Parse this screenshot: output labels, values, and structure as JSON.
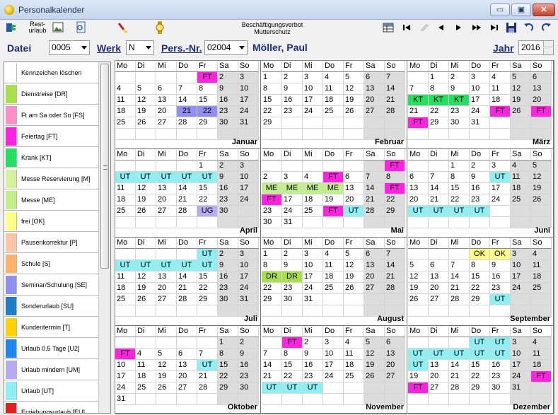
{
  "window": {
    "title": "Personalkalender",
    "minimize": "▭",
    "maximize": "▣",
    "close": "✕"
  },
  "toolbar": {
    "resturlaub_label_1": "Rest-",
    "resturlaub_label_2": "urlaub",
    "center_label_1": "Beschäftigungsverbot",
    "center_label_2": "Mutterschutz"
  },
  "filter": {
    "datei_label": "Datei",
    "datei_value": "0005",
    "werk_label": "Werk",
    "werk_value": "N",
    "persnr_label": "Pers.-Nr.",
    "persnr_value": "02004",
    "person_name": "Möller, Paul",
    "jahr_label": "Jahr",
    "jahr_value": "2016"
  },
  "legend": [
    {
      "label": "Kennzeichen löschen",
      "color": "#ffffff"
    },
    {
      "label": "Dienstreise [DR]",
      "color": "#a8e04a"
    },
    {
      "label": "Ft am Sa oder So [FS]",
      "color": "#ff8fc8"
    },
    {
      "label": "Feiertag [FT]",
      "color": "#ff22e0"
    },
    {
      "label": "Krank [KT]",
      "color": "#22e060"
    },
    {
      "label": "Messe Reservierung [M]",
      "color": "#d4f29a"
    },
    {
      "label": "Messe [ME]",
      "color": "#c2ee8c"
    },
    {
      "label": "frei [OK]",
      "color": "#ffff88"
    },
    {
      "label": "Pausenkorrektur [P]",
      "color": "#ffc4a8"
    },
    {
      "label": "Schule [S]",
      "color": "#ffb06a"
    },
    {
      "label": "Seminar/Schulung [SE]",
      "color": "#8f8ff2"
    },
    {
      "label": "Sonderurlaub [SU]",
      "color": "#1e7ec8"
    },
    {
      "label": "Kundentermin [T]",
      "color": "#ffd200"
    },
    {
      "label": "Urlaub 0.5 Tage [U2]",
      "color": "#1e86f0"
    },
    {
      "label": "Urlaub mindern [UM]",
      "color": "#b6acf0"
    },
    {
      "label": "Urlaub [UT]",
      "color": "#8ff0f4"
    },
    {
      "label": "Erziehungsurlaub [EU]",
      "color": "#e02020"
    }
  ],
  "marks": {
    "FT": "#ff22e0",
    "UT": "#8ff0f4",
    "KT": "#22e060",
    "ME": "#c2ee8c",
    "DR": "#a8e04a",
    "OK": "#ffff88",
    "UG": "#b6acf0",
    "SE": "#8f8ff2"
  },
  "weekdays": [
    "Mo",
    "Di",
    "Mi",
    "Do",
    "Fr",
    "Sa",
    "So"
  ],
  "months": [
    {
      "name": "Januar",
      "rows": [
        [
          "",
          "",
          "",
          "",
          "FT",
          "2",
          "3"
        ],
        [
          "4",
          "5",
          "6",
          "7",
          "8",
          "9",
          "10"
        ],
        [
          "11",
          "12",
          "13",
          "14",
          "15",
          "16",
          "17"
        ],
        [
          "18",
          "19",
          "20",
          "21",
          "22",
          "23",
          "24"
        ],
        [
          "25",
          "26",
          "27",
          "28",
          "29",
          "30",
          "31"
        ],
        [
          "",
          "",
          "",
          "",
          "",
          "",
          ""
        ]
      ],
      "colors": {
        "0,4": "FT",
        "3,3": "SE",
        "3,4": "SE"
      }
    },
    {
      "name": "Februar",
      "rows": [
        [
          "1",
          "2",
          "3",
          "4",
          "5",
          "6",
          "7"
        ],
        [
          "8",
          "9",
          "10",
          "11",
          "12",
          "13",
          "14"
        ],
        [
          "15",
          "16",
          "17",
          "18",
          "19",
          "20",
          "21"
        ],
        [
          "22",
          "23",
          "24",
          "25",
          "26",
          "27",
          "28"
        ],
        [
          "29",
          "",
          "",
          "",
          "",
          "",
          ""
        ],
        [
          "",
          "",
          "",
          "",
          "",
          "",
          ""
        ]
      ],
      "colors": {}
    },
    {
      "name": "März",
      "rows": [
        [
          "",
          "1",
          "2",
          "3",
          "4",
          "5",
          "6"
        ],
        [
          "7",
          "8",
          "9",
          "10",
          "11",
          "12",
          "13"
        ],
        [
          "KT",
          "KT",
          "KT",
          "17",
          "18",
          "19",
          "20"
        ],
        [
          "21",
          "22",
          "23",
          "24",
          "FT",
          "26",
          "FT"
        ],
        [
          "FT",
          "29",
          "30",
          "31",
          "",
          "",
          ""
        ],
        [
          "",
          "",
          "",
          "",
          "",
          "",
          ""
        ]
      ],
      "colors": {
        "2,0": "KT",
        "2,1": "KT",
        "2,2": "KT",
        "3,4": "FT",
        "3,6": "FT",
        "4,0": "FT"
      }
    },
    {
      "name": "April",
      "rows": [
        [
          "",
          "",
          "",
          "",
          "1",
          "2",
          "3"
        ],
        [
          "UT",
          "UT",
          "UT",
          "UT",
          "UT",
          "9",
          "10"
        ],
        [
          "11",
          "12",
          "13",
          "14",
          "15",
          "16",
          "17"
        ],
        [
          "18",
          "19",
          "20",
          "21",
          "22",
          "23",
          "24"
        ],
        [
          "25",
          "26",
          "27",
          "28",
          "UG",
          "30",
          ""
        ],
        [
          "",
          "",
          "",
          "",
          "",
          "",
          ""
        ]
      ],
      "colors": {
        "1,0": "UT",
        "1,1": "UT",
        "1,2": "UT",
        "1,3": "UT",
        "1,4": "UT",
        "4,4": "UG"
      }
    },
    {
      "name": "Mai",
      "rows": [
        [
          "",
          "",
          "",
          "",
          "",
          "",
          "FT"
        ],
        [
          "2",
          "3",
          "4",
          "FT",
          "6",
          "7",
          "8"
        ],
        [
          "ME",
          "ME",
          "ME",
          "ME",
          "13",
          "14",
          "FT"
        ],
        [
          "FT",
          "17",
          "18",
          "19",
          "20",
          "21",
          "22"
        ],
        [
          "23",
          "24",
          "25",
          "FT",
          "UT",
          "28",
          "29"
        ],
        [
          "30",
          "31",
          "",
          "",
          "",
          "",
          ""
        ]
      ],
      "colors": {
        "0,6": "FT",
        "1,3": "FT",
        "2,0": "ME",
        "2,1": "ME",
        "2,2": "ME",
        "2,3": "ME",
        "2,6": "FT",
        "3,0": "FT",
        "4,3": "FT",
        "4,4": "UT"
      }
    },
    {
      "name": "Juni",
      "rows": [
        [
          "",
          "",
          "1",
          "2",
          "3",
          "4",
          "5"
        ],
        [
          "6",
          "7",
          "8",
          "9",
          "UT",
          "11",
          "12"
        ],
        [
          "13",
          "14",
          "15",
          "16",
          "17",
          "18",
          "19"
        ],
        [
          "20",
          "21",
          "22",
          "23",
          "24",
          "25",
          "26"
        ],
        [
          "UT",
          "UT",
          "UT",
          "UT",
          "",
          "",
          ""
        ],
        [
          "",
          "",
          "",
          "",
          "",
          "",
          ""
        ]
      ],
      "colors": {
        "1,4": "UT",
        "4,0": "UT",
        "4,1": "UT",
        "4,2": "UT",
        "4,3": "UT"
      }
    },
    {
      "name": "Juli",
      "rows": [
        [
          "",
          "",
          "",
          "",
          "UT",
          "2",
          "3"
        ],
        [
          "UT",
          "UT",
          "UT",
          "UT",
          "UT",
          "9",
          "10"
        ],
        [
          "11",
          "12",
          "13",
          "14",
          "15",
          "16",
          "17"
        ],
        [
          "18",
          "19",
          "20",
          "21",
          "22",
          "23",
          "24"
        ],
        [
          "25",
          "26",
          "27",
          "28",
          "29",
          "30",
          "31"
        ],
        [
          "",
          "",
          "",
          "",
          "",
          "",
          ""
        ]
      ],
      "colors": {
        "0,4": "UT",
        "1,0": "UT",
        "1,1": "UT",
        "1,2": "UT",
        "1,3": "UT",
        "1,4": "UT"
      }
    },
    {
      "name": "August",
      "rows": [
        [
          "1",
          "2",
          "3",
          "4",
          "5",
          "6",
          "7"
        ],
        [
          "8",
          "9",
          "10",
          "11",
          "12",
          "13",
          "14"
        ],
        [
          "DR",
          "DR",
          "17",
          "18",
          "19",
          "20",
          "21"
        ],
        [
          "22",
          "23",
          "24",
          "25",
          "26",
          "27",
          "28"
        ],
        [
          "29",
          "30",
          "31",
          "",
          "",
          "",
          ""
        ],
        [
          "",
          "",
          "",
          "",
          "",
          "",
          ""
        ]
      ],
      "colors": {
        "2,0": "DR",
        "2,1": "DR"
      }
    },
    {
      "name": "September",
      "rows": [
        [
          "",
          "",
          "",
          "OK",
          "OK",
          "3",
          "4"
        ],
        [
          "5",
          "6",
          "7",
          "8",
          "9",
          "10",
          "11"
        ],
        [
          "12",
          "13",
          "14",
          "15",
          "16",
          "17",
          "18"
        ],
        [
          "19",
          "20",
          "21",
          "22",
          "23",
          "24",
          "25"
        ],
        [
          "26",
          "27",
          "28",
          "29",
          "UT",
          "",
          ""
        ],
        [
          "",
          "",
          "",
          "",
          "",
          "",
          ""
        ]
      ],
      "colors": {
        "0,3": "OK",
        "0,4": "OK",
        "4,4": "UT"
      }
    },
    {
      "name": "Oktober",
      "rows": [
        [
          "",
          "",
          "",
          "",
          "",
          "1",
          "2"
        ],
        [
          "FT",
          "4",
          "5",
          "6",
          "7",
          "8",
          "9"
        ],
        [
          "10",
          "11",
          "12",
          "13",
          "UT",
          "15",
          "16"
        ],
        [
          "17",
          "18",
          "19",
          "20",
          "21",
          "22",
          "23"
        ],
        [
          "24",
          "25",
          "26",
          "27",
          "28",
          "29",
          "30"
        ],
        [
          "31",
          "",
          "",
          "",
          "",
          "",
          ""
        ]
      ],
      "colors": {
        "1,0": "FT",
        "2,4": "UT"
      }
    },
    {
      "name": "November",
      "rows": [
        [
          "",
          "FT",
          "2",
          "3",
          "4",
          "5",
          "6"
        ],
        [
          "7",
          "8",
          "9",
          "10",
          "11",
          "12",
          "13"
        ],
        [
          "14",
          "15",
          "16",
          "17",
          "18",
          "19",
          "20"
        ],
        [
          "21",
          "22",
          "23",
          "24",
          "25",
          "26",
          "27"
        ],
        [
          "UT",
          "UT",
          "UT",
          "",
          "",
          "",
          ""
        ],
        [
          "",
          "",
          "",
          "",
          "",
          "",
          ""
        ]
      ],
      "colors": {
        "0,1": "FT",
        "4,0": "UT",
        "4,1": "UT",
        "4,2": "UT"
      }
    },
    {
      "name": "Dezember",
      "rows": [
        [
          "",
          "",
          "",
          "UT",
          "UT",
          "3",
          "4"
        ],
        [
          "UT",
          "UT",
          "UT",
          "UT",
          "UT",
          "10",
          "11"
        ],
        [
          "UT",
          "13",
          "14",
          "15",
          "16",
          "17",
          "18"
        ],
        [
          "19",
          "20",
          "21",
          "22",
          "23",
          "24",
          "FT"
        ],
        [
          "FT",
          "27",
          "28",
          "29",
          "30",
          "31",
          ""
        ],
        [
          "",
          "",
          "",
          "",
          "",
          "",
          ""
        ]
      ],
      "colors": {
        "0,3": "UT",
        "0,4": "UT",
        "1,0": "UT",
        "1,1": "UT",
        "1,2": "UT",
        "1,3": "UT",
        "1,4": "UT",
        "2,0": "UT",
        "3,6": "FT",
        "4,0": "FT"
      }
    }
  ]
}
